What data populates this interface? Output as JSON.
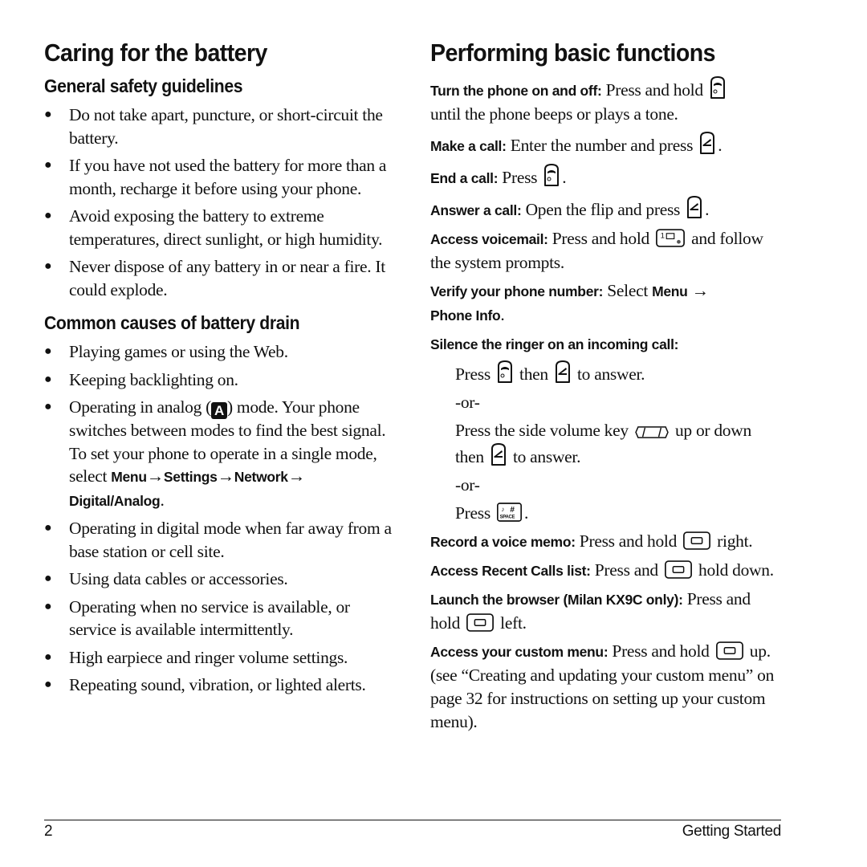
{
  "left": {
    "title": "Caring for the battery",
    "safety": {
      "heading": "General safety guidelines",
      "items": [
        "Do not take apart, puncture, or short-circuit the battery.",
        "If you have not used the battery for more than a month, recharge it before using your phone.",
        "Avoid exposing the battery to extreme temperatures, direct sunlight, or high humidity.",
        "Never dispose of any battery in or near a fire. It could explode."
      ]
    },
    "drain": {
      "heading": "Common causes of battery drain",
      "items": [
        "Playing games or using the Web.",
        "Keeping backlighting on."
      ],
      "analog_item": {
        "pre": "Operating in analog (",
        "icon_letter": "A",
        "post": ") mode. Your phone switches between modes to find the best signal. To set your phone to operate in a single mode, select ",
        "menu": "Menu",
        "arrow": "→",
        "settings": "Settings",
        "network": "Network",
        "digital_analog": "Digital/Analog",
        "end": "."
      },
      "items_after": [
        "Operating in digital mode when far away from a base station or cell site.",
        "Using data cables or accessories.",
        "Operating when no service is available, or service is available intermittently.",
        "High earpiece and ringer volume settings.",
        "Repeating sound, vibration, or lighted alerts."
      ]
    }
  },
  "right": {
    "title": "Performing basic functions",
    "turn_on": {
      "label": "Turn the phone on and off:",
      "text1": " Press and hold ",
      "text2": "until the phone beeps or plays a tone."
    },
    "make_call": {
      "label": "Make a call:",
      "text": " Enter the number and press ",
      "end": "."
    },
    "end_call": {
      "label": "End a call:",
      "text": " Press ",
      "end": "."
    },
    "answer_call": {
      "label": "Answer a call:",
      "text": " Open the flip and press ",
      "end": "."
    },
    "voicemail": {
      "label": "Access voicemail:",
      "text1": " Press and hold ",
      "text2": " and follow the system prompts."
    },
    "verify": {
      "label": "Verify your phone number:",
      "text": " Select ",
      "menu": "Menu",
      "arrow": " →",
      "phone_info": "Phone Info",
      "end": "."
    },
    "silence": {
      "label": "Silence the ringer on an incoming call:",
      "opt1": {
        "press": "Press ",
        "then": " then ",
        "end": " to answer."
      },
      "or1": "-or-",
      "opt2": {
        "text1": "Press the side volume key ",
        "text2": " up or down then ",
        "end": " to answer."
      },
      "or2": "-or-",
      "opt3": {
        "press": "Press ",
        "end": "."
      }
    },
    "voice_memo": {
      "label": "Record a voice memo:",
      "text": " Press and hold ",
      "end": " right."
    },
    "recent_calls": {
      "label": "Access Recent Calls list:",
      "text": " Press and ",
      "end": " hold down."
    },
    "browser": {
      "label": "Launch the browser (Milan KX9C only):",
      "text": " Press and hold ",
      "end": " left."
    },
    "custom_menu": {
      "label": "Access your custom menu:",
      "text": " Press and hold ",
      "end": " up. (see “Creating and updating your custom menu” on page 32 for instructions on setting up your custom menu)."
    }
  },
  "icons": {
    "end_key": "end-power-key-icon",
    "send_key": "send-key-icon",
    "voicemail_key": "key-1-voicemail-icon",
    "volume_key": "side-volume-key-icon",
    "space_key": "pound-space-key-icon",
    "nav_key": "navigation-key-icon",
    "analog": "analog-mode-icon"
  },
  "footer": {
    "page_number": "2",
    "section": "Getting Started"
  }
}
